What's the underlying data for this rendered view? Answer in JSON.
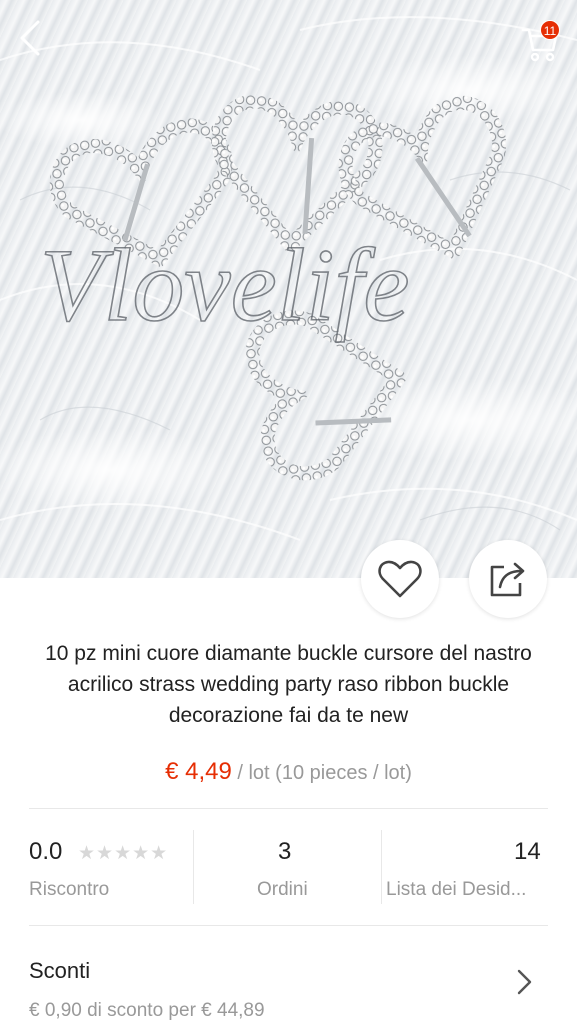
{
  "header": {
    "back_icon": "chevron-left-icon",
    "cart_icon": "cart-icon",
    "cart_count": "11"
  },
  "image": {
    "watermark": "Vlovelife"
  },
  "actions": {
    "wishlist_icon": "heart-outline-icon",
    "share_icon": "share-icon"
  },
  "product": {
    "title": "10 pz mini cuore diamante buckle cursore del nastro acrilico strass wedding party raso ribbon buckle decorazione fai da te new",
    "price": "€ 4,49",
    "unit": "/ lot (10 pieces / lot)"
  },
  "stats": {
    "rating_value": "0.0",
    "rating_stars": 0,
    "rating_label": "Riscontro",
    "orders_value": "3",
    "orders_label": "Ordini",
    "wishlist_value": "14",
    "wishlist_label": "Lista dei Desid..."
  },
  "discounts": {
    "title": "Sconti",
    "detail": "€ 0,90 di sconto per € 44,89"
  },
  "colors": {
    "accent": "#e62e04",
    "muted_text": "#999999",
    "text": "#222222"
  }
}
